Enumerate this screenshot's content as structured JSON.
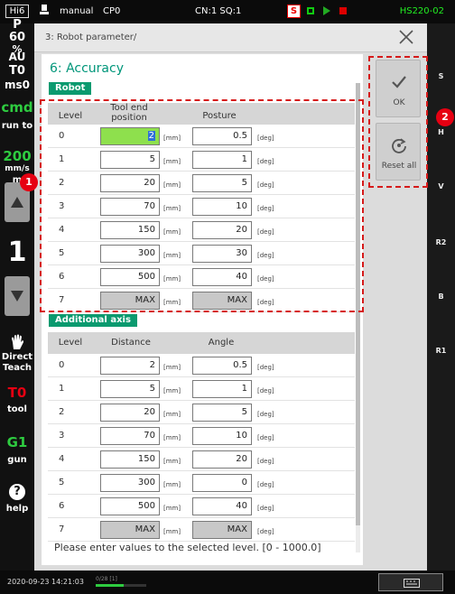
{
  "topbar": {
    "hi6": "Hi6",
    "mode": "manual",
    "cp": "CP0",
    "cn_sq": "CN:1 SQ:1",
    "s_badge": "S",
    "model": "HS220-02"
  },
  "leftbar": {
    "p": "P",
    "speed_pct": "60",
    "pct": "%",
    "au": "AU",
    "t0": "T0",
    "ms0": "ms0",
    "cmd": "cmd",
    "run_to": "run to",
    "speed_mm": "200",
    "mm_unit": "mm/s",
    "mm": "m",
    "step": "1",
    "direct_teach": "Direct Teach",
    "tool_code": "T0",
    "tool_label": "tool",
    "gun_code": "G1",
    "gun_label": "gun",
    "help_label": "help",
    "help_glyph": "?"
  },
  "callouts": {
    "one": "1",
    "two": "2"
  },
  "panel": {
    "breadcrumb": "3: Robot parameter/",
    "section_title": "6: Accuracy",
    "robot_badge": "Robot",
    "additional_badge": "Additional axis",
    "message": "Please enter values to the selected level. [0 - 1000.0]"
  },
  "robot_table": {
    "headers": {
      "level": "Level",
      "col1": "Tool end position",
      "col2": "Posture"
    },
    "unit1": "[mm]",
    "unit2": "[deg]",
    "rows": [
      {
        "level": "0",
        "v1": "2",
        "v2": "0.5"
      },
      {
        "level": "1",
        "v1": "5",
        "v2": "1"
      },
      {
        "level": "2",
        "v1": "20",
        "v2": "5"
      },
      {
        "level": "3",
        "v1": "70",
        "v2": "10"
      },
      {
        "level": "4",
        "v1": "150",
        "v2": "20"
      },
      {
        "level": "5",
        "v1": "300",
        "v2": "30"
      },
      {
        "level": "6",
        "v1": "500",
        "v2": "40"
      },
      {
        "level": "7",
        "v1": "MAX",
        "v2": "MAX"
      }
    ]
  },
  "axis_table": {
    "headers": {
      "level": "Level",
      "col1": "Distance",
      "col2": "Angle"
    },
    "unit1": "[mm]",
    "unit2": "[deg]",
    "rows": [
      {
        "level": "0",
        "v1": "2",
        "v2": "0.5"
      },
      {
        "level": "1",
        "v1": "5",
        "v2": "1"
      },
      {
        "level": "2",
        "v1": "20",
        "v2": "5"
      },
      {
        "level": "3",
        "v1": "70",
        "v2": "10"
      },
      {
        "level": "4",
        "v1": "150",
        "v2": "20"
      },
      {
        "level": "5",
        "v1": "300",
        "v2": "0"
      },
      {
        "level": "6",
        "v1": "500",
        "v2": "40"
      },
      {
        "level": "7",
        "v1": "MAX",
        "v2": "MAX"
      }
    ]
  },
  "actions": {
    "ok": "OK",
    "reset_all": "Reset all"
  },
  "rightbar": {
    "axes": [
      "S",
      "H",
      "V",
      "R2",
      "B",
      "R1"
    ]
  },
  "statusbar": {
    "datetime": "2020-09-23 14:21:03",
    "progress_label": "0/28 [1]",
    "progress_fraction": 0.55
  },
  "colors": {
    "accent": "#00967a",
    "selected_cell": "#8ee04d",
    "callout": "#e60012"
  }
}
